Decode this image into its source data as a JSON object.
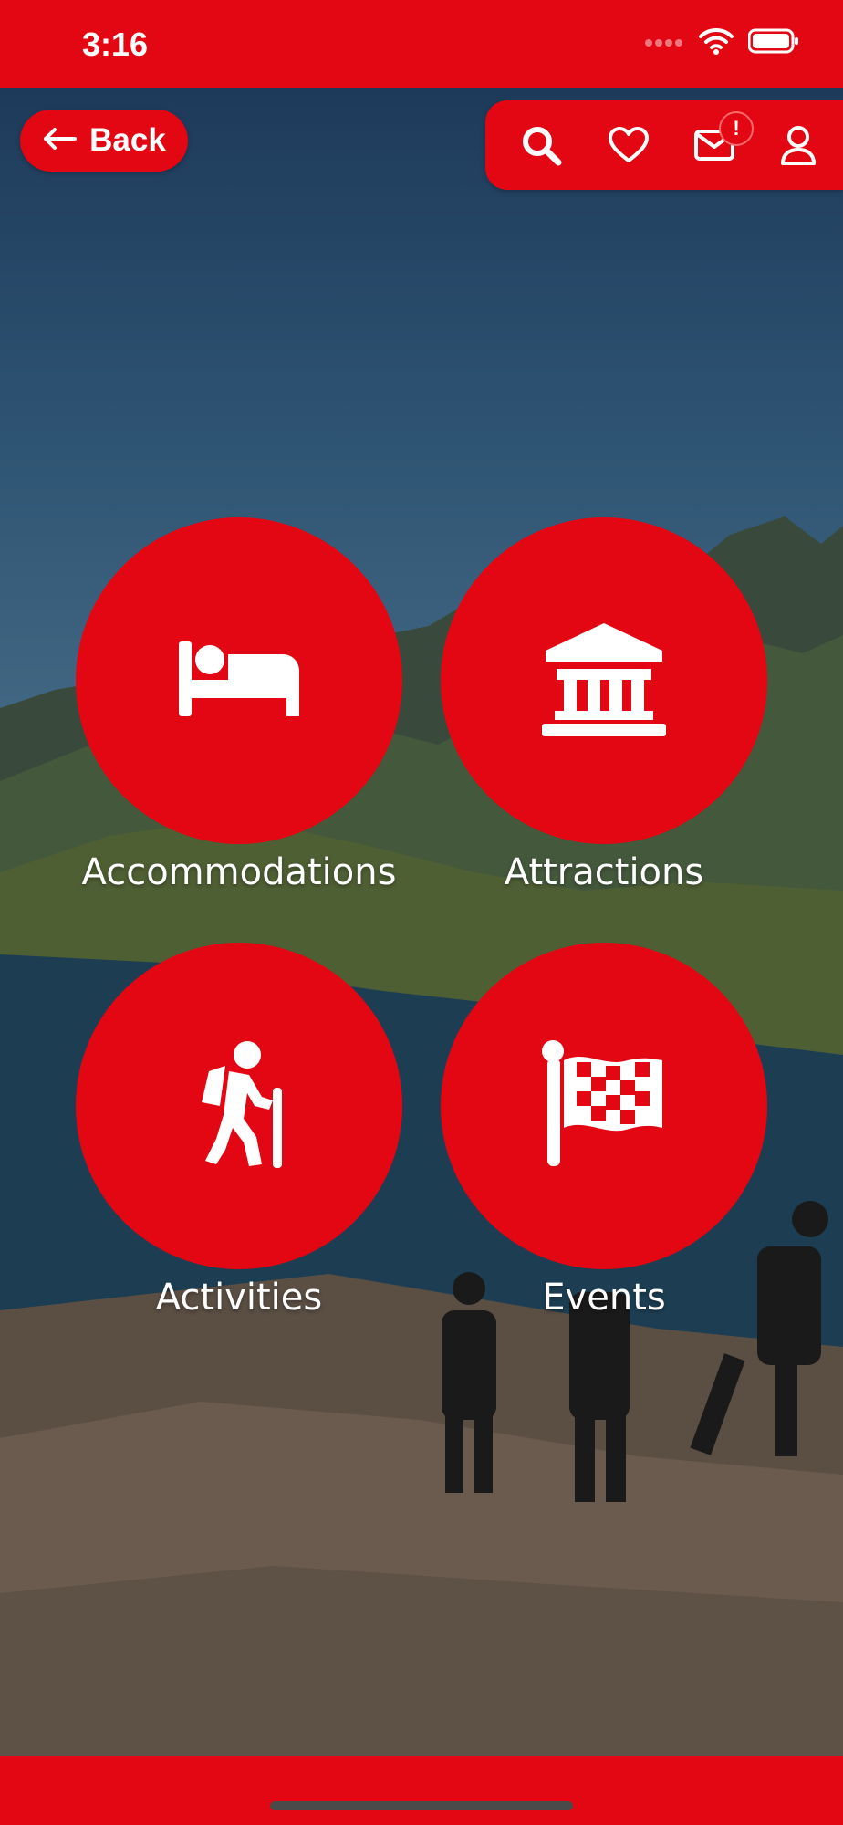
{
  "status_bar": {
    "time": "3:16"
  },
  "header": {
    "back_label": "Back",
    "notification_badge": "!"
  },
  "toolbar_icons": [
    "search-icon",
    "heart-icon",
    "mail-icon",
    "user-icon"
  ],
  "categories": [
    {
      "label": "Accommodations",
      "icon": "bed-icon"
    },
    {
      "label": "Attractions",
      "icon": "museum-icon"
    },
    {
      "label": "Activities",
      "icon": "hiker-icon"
    },
    {
      "label": "Events",
      "icon": "checkered-flag-icon"
    }
  ],
  "colors": {
    "brand_red": "#e30613",
    "text": "#ffffff"
  }
}
